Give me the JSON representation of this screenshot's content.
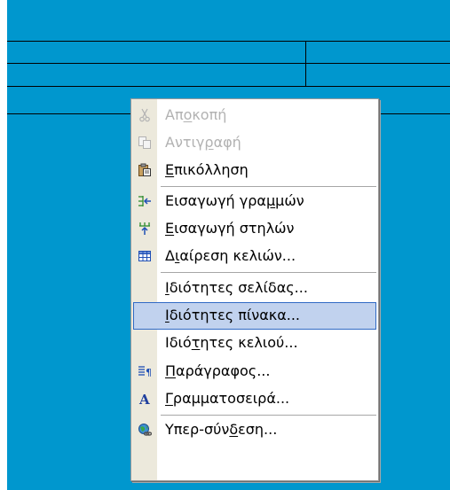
{
  "menu": {
    "items": [
      {
        "id": "cut",
        "pre": "Απ",
        "u": "ο",
        "post": "κοπή",
        "icon": "scissors-icon",
        "disabled": true
      },
      {
        "id": "copy",
        "pre": "Αντιγ",
        "u": "ρ",
        "post": "αφή",
        "icon": "copy-icon",
        "disabled": true
      },
      {
        "id": "paste",
        "pre": "",
        "u": "Ε",
        "post": "πικόλληση",
        "icon": "paste-icon",
        "disabled": false
      },
      {
        "id": "insert-rows",
        "pre": "Εισαγωγή γρα",
        "u": "μ",
        "post": "μών",
        "icon": "insert-rows-icon",
        "disabled": false
      },
      {
        "id": "insert-columns",
        "pre": "",
        "u": "Ε",
        "post": "ισαγωγή στηλών",
        "icon": "insert-columns-icon",
        "disabled": false
      },
      {
        "id": "split-cells",
        "pre": "Δ",
        "u": "ι",
        "post": "αίρεση κελιών...",
        "icon": "split-cells-icon",
        "disabled": false
      },
      {
        "id": "page-properties",
        "pre": "",
        "u": "Ι",
        "post": "διότητες σελίδας...",
        "icon": "",
        "disabled": false
      },
      {
        "id": "table-properties",
        "pre": "",
        "u": "Ι",
        "post": "διότητες πίνακα...",
        "icon": "",
        "disabled": false,
        "selected": true
      },
      {
        "id": "cell-properties",
        "pre": "Ιδιό",
        "u": "τ",
        "post": "ητες κελιού...",
        "icon": "",
        "disabled": false
      },
      {
        "id": "paragraph",
        "pre": "",
        "u": "Π",
        "post": "αράγραφος...",
        "icon": "paragraph-icon",
        "disabled": false
      },
      {
        "id": "font",
        "pre": "",
        "u": "Γ",
        "post": "ραμματοσειρά...",
        "icon": "font-icon",
        "disabled": false
      },
      {
        "id": "hyperlink",
        "pre": "Υπερ-σύν",
        "u": "δ",
        "post": "εση...",
        "icon": "hyperlink-icon",
        "disabled": false
      }
    ]
  },
  "colors": {
    "table_background": "#0097ce",
    "menu_gutter": "#ece9dc",
    "selection_fill": "#c1d2ee",
    "selection_border": "#316ac5",
    "disabled_text": "#b2b2b2"
  }
}
